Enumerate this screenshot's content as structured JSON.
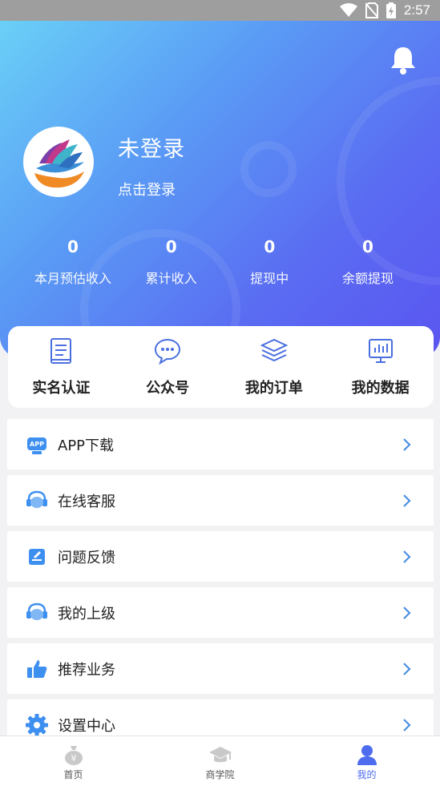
{
  "status_bar": {
    "time": "2:57",
    "icons": [
      "wifi-icon",
      "no-sim-icon",
      "battery-charging-icon"
    ]
  },
  "header": {
    "bell_icon": "bell-icon"
  },
  "profile": {
    "name": "未登录",
    "login_link": "点击登录"
  },
  "stats": [
    {
      "value": "0",
      "label": "本月预估收入"
    },
    {
      "value": "0",
      "label": "累计收入"
    },
    {
      "value": "0",
      "label": "提现中"
    },
    {
      "value": "0",
      "label": "余额提现"
    }
  ],
  "quick_actions": [
    {
      "label": "实名认证",
      "icon": "id-book-icon"
    },
    {
      "label": "公众号",
      "icon": "chat-bubble-icon"
    },
    {
      "label": "我的订单",
      "icon": "layers-icon"
    },
    {
      "label": "我的数据",
      "icon": "data-chart-icon"
    }
  ],
  "menu": [
    {
      "label": "APP下载",
      "icon": "app-download-icon"
    },
    {
      "label": "在线客服",
      "icon": "headset-icon"
    },
    {
      "label": "问题反馈",
      "icon": "feedback-icon"
    },
    {
      "label": "我的上级",
      "icon": "headset-icon"
    },
    {
      "label": "推荐业务",
      "icon": "thumbs-up-icon"
    },
    {
      "label": "设置中心",
      "icon": "gear-icon"
    }
  ],
  "tabs": [
    {
      "label": "首页",
      "icon": "money-bag-icon",
      "active": false
    },
    {
      "label": "商学院",
      "icon": "graduation-cap-icon",
      "active": false
    },
    {
      "label": "我的",
      "icon": "person-icon",
      "active": true
    }
  ],
  "colors": {
    "accent": "#4d6cf0",
    "menu_icon": "#3d8ff0",
    "chevron": "#4a90e2",
    "inactive_tab": "#c9c9c9"
  }
}
